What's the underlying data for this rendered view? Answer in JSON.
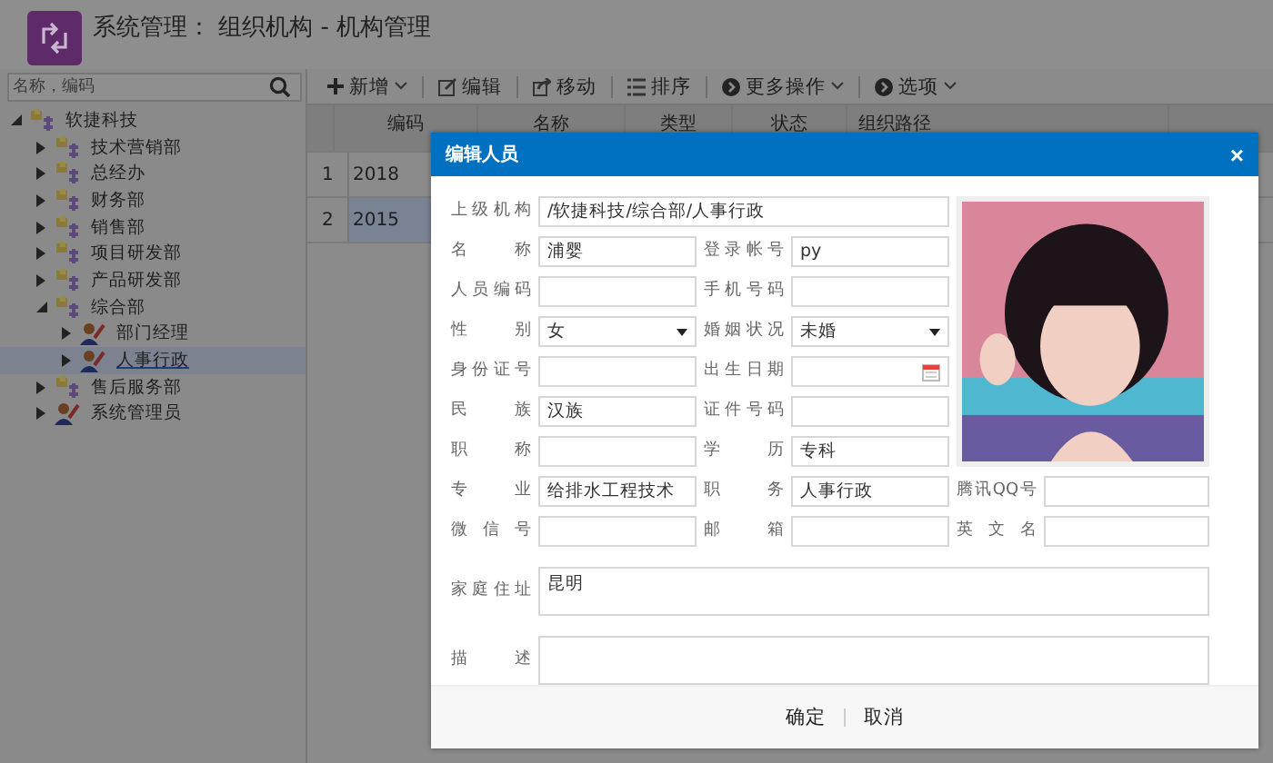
{
  "header": {
    "title": "系统管理： 组织机构 - 机构管理"
  },
  "sidebar": {
    "search": {
      "placeholder": "名称，编码"
    },
    "tree": [
      {
        "label": "软捷科技",
        "kind": "org",
        "expanded": true,
        "selected": false,
        "children": [
          {
            "label": "技术营销部",
            "kind": "org",
            "expanded": false,
            "selected": false
          },
          {
            "label": "总经办",
            "kind": "org",
            "expanded": false,
            "selected": false
          },
          {
            "label": "财务部",
            "kind": "org",
            "expanded": false,
            "selected": false
          },
          {
            "label": "销售部",
            "kind": "org",
            "expanded": false,
            "selected": false
          },
          {
            "label": "项目研发部",
            "kind": "org",
            "expanded": false,
            "selected": false
          },
          {
            "label": "产品研发部",
            "kind": "org",
            "expanded": false,
            "selected": false
          },
          {
            "label": "综合部",
            "kind": "org",
            "expanded": true,
            "selected": false,
            "children": [
              {
                "label": "部门经理",
                "kind": "person",
                "expanded": false,
                "selected": false
              },
              {
                "label": "人事行政",
                "kind": "person",
                "expanded": false,
                "selected": true
              }
            ]
          },
          {
            "label": "售后服务部",
            "kind": "org",
            "expanded": false,
            "selected": false
          },
          {
            "label": "系统管理员",
            "kind": "person",
            "expanded": false,
            "selected": false
          }
        ]
      }
    ]
  },
  "toolbar": [
    {
      "label": "新增",
      "kind": "plus",
      "dropdown": true
    },
    {
      "label": "编辑",
      "kind": "edit",
      "dropdown": false
    },
    {
      "label": "移动",
      "kind": "share",
      "dropdown": false
    },
    {
      "label": "排序",
      "kind": "list",
      "dropdown": false
    },
    {
      "label": "更多操作",
      "kind": "circle",
      "dropdown": true
    },
    {
      "label": "选项",
      "kind": "circle",
      "dropdown": true
    }
  ],
  "table": {
    "columns": [
      "编码",
      "名称",
      "类型",
      "状态",
      "组织路径"
    ],
    "rows": [
      {
        "number": "1",
        "code": "2018",
        "selected": false
      },
      {
        "number": "2",
        "code": "2015",
        "selected": true
      }
    ]
  },
  "dialog": {
    "title": "编辑人员",
    "close": "×",
    "fields": [
      {
        "label": "上级机构",
        "kind": "wide",
        "value": "/软捷科技/综合部/人事行政"
      },
      {
        "label": "名 称",
        "kind": "text",
        "value": "浦婴"
      },
      {
        "label": "登录帐号",
        "kind": "text",
        "value": "py"
      },
      {
        "label": "人员编码",
        "kind": "text"
      },
      {
        "label": "手机号码",
        "kind": "text"
      },
      {
        "label": "性 别",
        "kind": "select",
        "value": "女"
      },
      {
        "label": "婚姻状况",
        "kind": "select",
        "value": "未婚"
      },
      {
        "label": "身份证号",
        "kind": "text"
      },
      {
        "label": "出生日期",
        "kind": "date"
      },
      {
        "label": "民 族",
        "kind": "text",
        "value": "汉族"
      },
      {
        "label": "证件号码",
        "kind": "text"
      },
      {
        "label": "职 称",
        "kind": "text"
      },
      {
        "label": "学 历",
        "kind": "text",
        "value": "专科"
      },
      {
        "label": "专 业",
        "kind": "text",
        "value": "给排水工程技术"
      },
      {
        "label": "职 务",
        "kind": "text",
        "value": "人事行政"
      },
      {
        "label": "腾讯QQ号",
        "kind": "text"
      },
      {
        "label": "微 信 号",
        "kind": "text"
      },
      {
        "label": "邮 箱",
        "kind": "text"
      },
      {
        "label": "英 文 名",
        "kind": "text"
      },
      {
        "label": "家庭住址",
        "kind": "textarea",
        "value": "昆明"
      },
      {
        "label": "描 述",
        "kind": "textarea"
      }
    ],
    "buttons": [
      "确定",
      "取消"
    ]
  }
}
